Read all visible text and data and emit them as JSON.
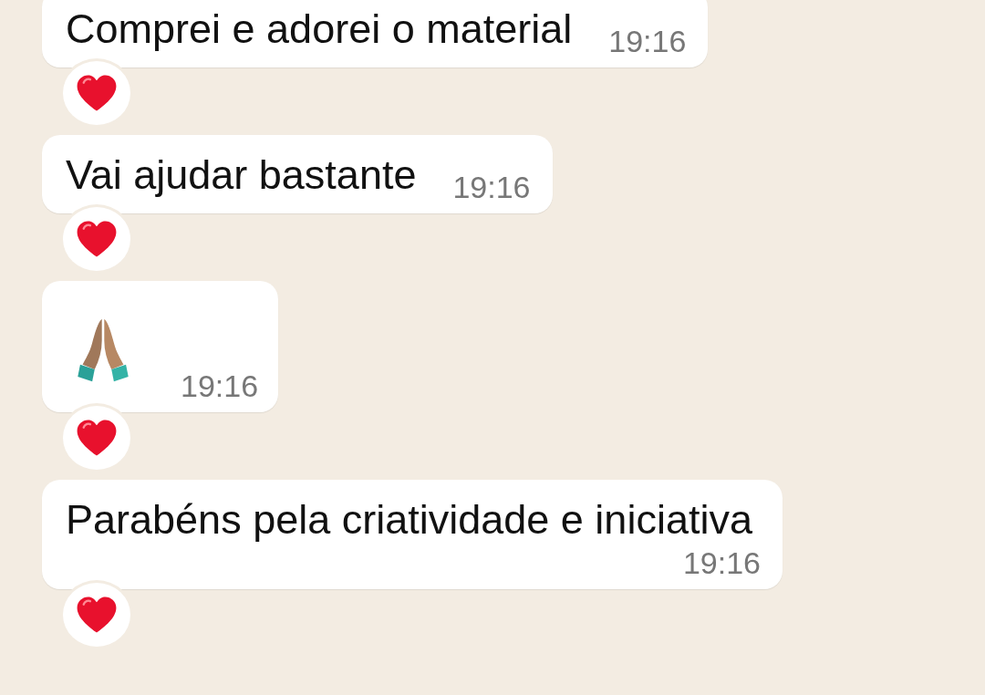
{
  "messages": [
    {
      "kind": "text",
      "text": "Comprei e adorei o material",
      "time": "19:16",
      "reactions": [
        {
          "kind": "heart"
        }
      ]
    },
    {
      "kind": "text",
      "text": "Vai ajudar bastante",
      "time": "19:16",
      "reactions": [
        {
          "kind": "heart"
        }
      ]
    },
    {
      "kind": "emoji",
      "time": "19:16",
      "reactions": [
        {
          "kind": "heart"
        }
      ]
    },
    {
      "kind": "text",
      "text": "Parabéns pela criatividade e iniciativa",
      "time": "19:16",
      "reactions": [
        {
          "kind": "heart"
        }
      ]
    }
  ]
}
